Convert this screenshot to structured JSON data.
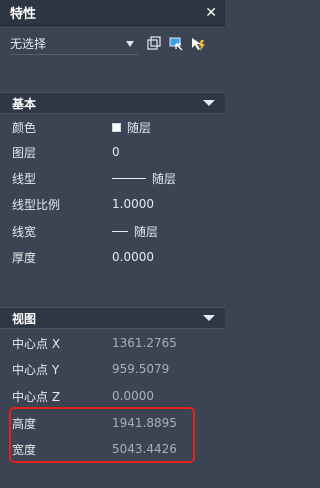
{
  "header": {
    "title": "特性",
    "close_glyph": "✕"
  },
  "selection": {
    "value": "无选择"
  },
  "toolbar": {
    "icons": [
      "select-objects-icon",
      "quick-select-icon",
      "toggle-pickadd-icon"
    ]
  },
  "sections": {
    "basic": {
      "title": "基本",
      "rows": [
        {
          "label": "颜色",
          "value": "随层"
        },
        {
          "label": "图层",
          "value": "0"
        },
        {
          "label": "线型",
          "value": "随层"
        },
        {
          "label": "线型比例",
          "value": "1.0000"
        },
        {
          "label": "线宽",
          "value": "随层"
        },
        {
          "label": "厚度",
          "value": "0.0000"
        }
      ]
    },
    "view": {
      "title": "视图",
      "rows": [
        {
          "label": "中心点 X",
          "value": "1361.2765"
        },
        {
          "label": "中心点 Y",
          "value": "959.5079"
        },
        {
          "label": "中心点 Z",
          "value": "0.0000"
        },
        {
          "label": "高度",
          "value": "1941.8895"
        },
        {
          "label": "宽度",
          "value": "5043.4426"
        }
      ]
    }
  },
  "colors": {
    "panel_bg": "#3b4453",
    "header_bg": "#2e3542",
    "highlight": "#e2201c"
  }
}
